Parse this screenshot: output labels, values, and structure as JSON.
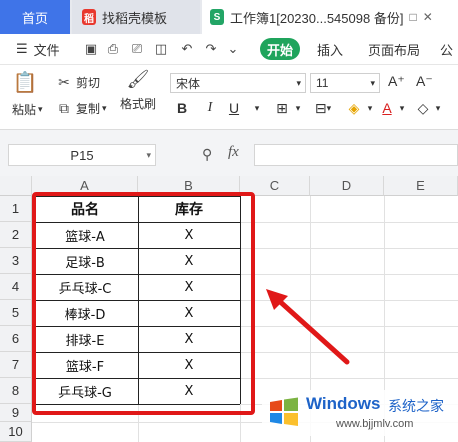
{
  "tabs": {
    "home": "首页",
    "template": "找稻壳模板",
    "document": "工作簿1[20230...545098 备份]"
  },
  "menu": {
    "file": "文件",
    "start": "开始",
    "insert": "插入",
    "page_layout": "页面布局",
    "formula_partial": "公"
  },
  "ribbon": {
    "paste": "粘贴",
    "cut": "剪切",
    "copy": "复制",
    "format_painter": "格式刷",
    "font_name": "宋体",
    "font_size": "11",
    "bold": "B",
    "italic": "I",
    "underline": "U",
    "grow_font": "A⁺",
    "shrink_font": "A⁻"
  },
  "formula_bar": {
    "cell_ref": "P15",
    "fx": "fx"
  },
  "sheet": {
    "columns": [
      "A",
      "B",
      "C",
      "D",
      "E"
    ],
    "rows": [
      "1",
      "2",
      "3",
      "4",
      "5",
      "6",
      "7",
      "8",
      "9",
      "10"
    ],
    "header": {
      "a": "品名",
      "b": "库存"
    },
    "data": [
      {
        "name": "篮球-A",
        "stock": "X"
      },
      {
        "name": "足球-B",
        "stock": "X"
      },
      {
        "name": "乒乓球-C",
        "stock": "X"
      },
      {
        "name": "棒球-D",
        "stock": "X"
      },
      {
        "name": "排球-E",
        "stock": "X"
      },
      {
        "name": "篮球-F",
        "stock": "X"
      },
      {
        "name": "乒乓球-G",
        "stock": "X"
      }
    ]
  },
  "watermark": {
    "brand": "Windows",
    "suffix": "系统之家",
    "url": "www.bjjmlv.com"
  },
  "colors": {
    "accent_blue": "#3f74e8",
    "start_green": "#1fa45c",
    "highlight_red": "#e01818"
  }
}
